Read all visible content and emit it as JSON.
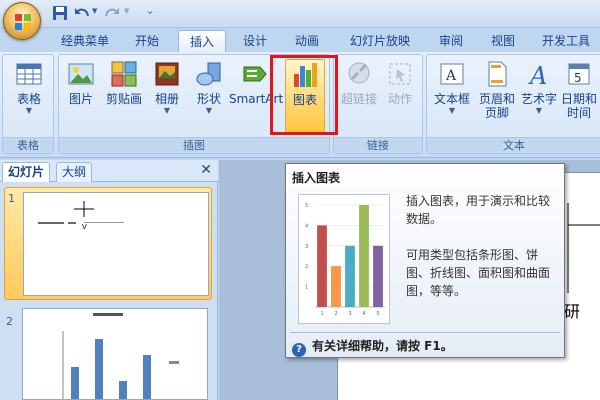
{
  "tabs": [
    "经典菜单",
    "开始",
    "插入",
    "设计",
    "动画",
    "幻灯片放映",
    "审阅",
    "视图",
    "开发工具"
  ],
  "ribbon": {
    "groups": {
      "table": "表格",
      "illustrations": "插图",
      "links": "链接",
      "text": "文本"
    },
    "buttons": {
      "table": "表格",
      "picture": "图片",
      "clipart": "剪贴画",
      "album": "相册",
      "shapes": "形状",
      "smartart": "SmartArt",
      "chart": "图表",
      "hyperlink": "超链接",
      "action": "动作",
      "textbox": "文本框",
      "header_footer_1": "页眉和",
      "header_footer_2": "页脚",
      "wordart": "艺术字",
      "datetime_1": "日期和",
      "datetime_2": "时间"
    }
  },
  "left_panel": {
    "tab_slides": "幻灯片",
    "tab_outline": "大纲",
    "close": "✕",
    "slide1_num": "1",
    "slide2_num": "2"
  },
  "slide": {
    "partial_text": "研"
  },
  "tooltip": {
    "title": "插入图表",
    "desc1": "插入图表，用于演示和比较数据。",
    "desc2": "可用类型包括条形图、饼图、折线图、面积图和曲面图，等等。",
    "help": "有关详细帮助，请按 F1。",
    "chart_data": {
      "type": "bar",
      "categories": [
        "1",
        "2",
        "3",
        "4",
        "5"
      ],
      "values": [
        4,
        2,
        3,
        5,
        3
      ],
      "ylim": [
        0,
        5
      ],
      "ticks": [
        "5",
        "4",
        "3",
        "2",
        "1"
      ],
      "colors": [
        "#c0504d",
        "#f79646",
        "#4bacc6",
        "#9bbb59",
        "#8064a2"
      ]
    }
  },
  "colors": {
    "highlight_red": "#e8121b",
    "ribbon_blue": "#dce9f9"
  }
}
